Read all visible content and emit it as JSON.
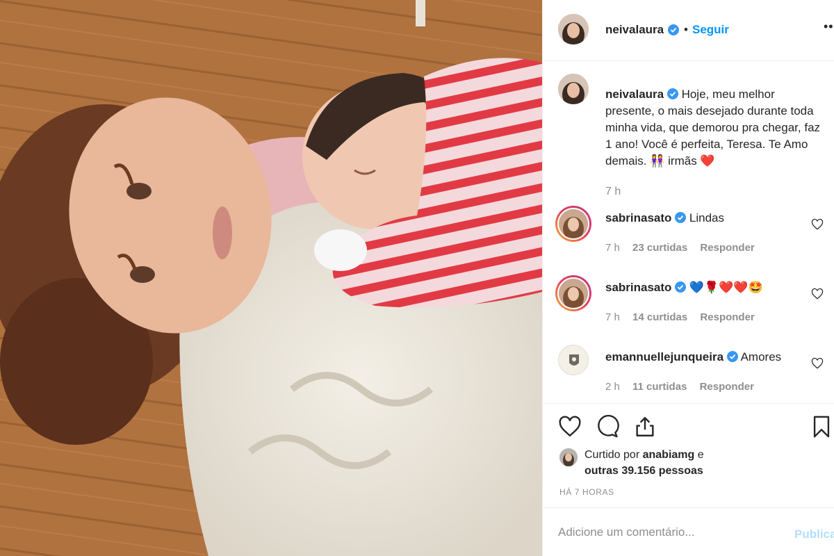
{
  "post": {
    "author": "neivalaura",
    "follow_label": "Seguir",
    "dot": "•",
    "more": "••",
    "caption": "Hoje, meu melhor presente, o mais desejado durante toda minha vida, que demorou pra chegar, faz 1 ano! Você é perfeita, Teresa. Te Amo demais. 👭 irmãs ❤️",
    "caption_time": "7 h"
  },
  "comments": [
    {
      "user": "sabrinasato",
      "text": "Lindas",
      "time": "7 h",
      "likes": "23 curtidas",
      "reply": "Responder"
    },
    {
      "user": "sabrinasato",
      "text": "💙🌹❤️❤️🤩",
      "time": "7 h",
      "likes": "14 curtidas",
      "reply": "Responder"
    },
    {
      "user": "emannuellejunqueira",
      "text": "Amores",
      "time": "2 h",
      "likes": "11 curtidas",
      "reply": "Responder"
    }
  ],
  "likes": {
    "prefix": "Curtido por",
    "user": "anabiamg",
    "conj": "e",
    "others": "outras 39.156 pessoas"
  },
  "posted_ago": "HÁ 7 HORAS",
  "add_comment": {
    "placeholder": "Adicione um comentário...",
    "publish": "Publicar"
  },
  "colors": {
    "link": "#0095f6",
    "verified": "#3897f0",
    "muted": "#8e8e8e",
    "publish_disabled": "#b2dffc"
  },
  "icons": [
    "verified-badge-icon",
    "heart-icon",
    "comment-icon",
    "share-icon",
    "bookmark-icon"
  ]
}
